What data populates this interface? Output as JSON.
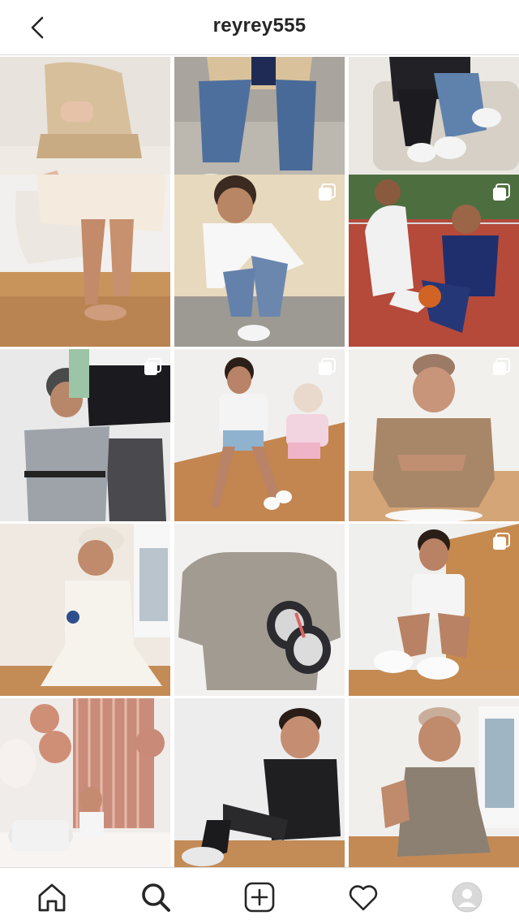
{
  "header": {
    "username": "reyrey555",
    "back_icon": "chevron-left-icon"
  },
  "grid": {
    "columns": 3,
    "rows": 5,
    "posts": [
      {
        "index": 1,
        "multi_image": false
      },
      {
        "index": 2,
        "multi_image": false
      },
      {
        "index": 3,
        "multi_image": false
      },
      {
        "index": 4,
        "multi_image": false
      },
      {
        "index": 5,
        "multi_image": true
      },
      {
        "index": 6,
        "multi_image": true
      },
      {
        "index": 7,
        "multi_image": true
      },
      {
        "index": 8,
        "multi_image": true
      },
      {
        "index": 9,
        "multi_image": true
      },
      {
        "index": 10,
        "multi_image": false
      },
      {
        "index": 11,
        "multi_image": false
      },
      {
        "index": 12,
        "multi_image": true
      },
      {
        "index": 13,
        "multi_image": false
      },
      {
        "index": 14,
        "multi_image": false
      },
      {
        "index": 15,
        "multi_image": false
      }
    ]
  },
  "tabbar": {
    "items": [
      "home-icon",
      "search-icon",
      "new-post-icon",
      "activity-heart-icon",
      "profile-avatar-icon"
    ],
    "active": "search-icon"
  },
  "colors": {
    "divider": "#dbdbdb",
    "text": "#262626",
    "background": "#ffffff"
  }
}
